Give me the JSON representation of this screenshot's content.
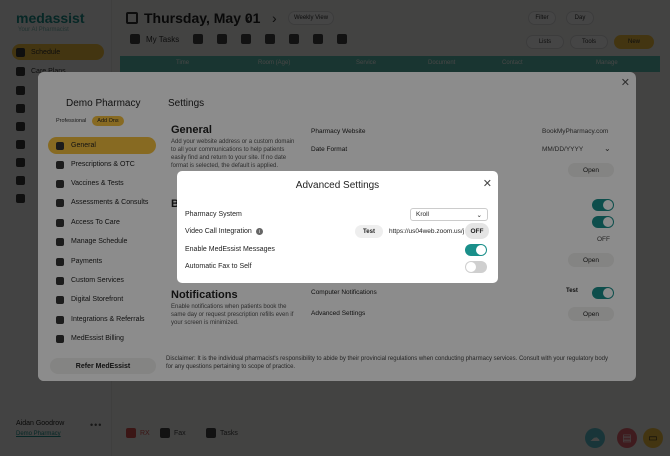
{
  "app": {
    "brand": "medassist",
    "brand_sub": "Your AI Pharmacist",
    "nav": [
      {
        "label": "Schedule",
        "active": true
      },
      {
        "label": "Care Plans",
        "active": false
      },
      {
        "label": "",
        "active": false
      },
      {
        "label": "",
        "active": false
      },
      {
        "label": "",
        "active": false
      },
      {
        "label": "",
        "active": false
      },
      {
        "label": "",
        "active": false
      },
      {
        "label": "",
        "active": false
      },
      {
        "label": "",
        "active": false
      }
    ],
    "user_name": "Aidan Goodrow",
    "user_pharmacy": "Demo Pharmacy",
    "date": "Thursday, May 01",
    "view_toggle": "Weekly View",
    "my_tasks": "My Tasks",
    "filter_labels": [
      "Filter",
      "Day"
    ],
    "toolbar_pills": [
      "Lists",
      "Tools",
      "New"
    ],
    "table_headers": [
      "Time",
      "Room (Age)",
      "Service",
      "Document",
      "Contact",
      "Manage"
    ],
    "bottom_items": [
      "RX",
      "Fax",
      "Tasks"
    ],
    "accent": "#1a8f8a",
    "highlight": "#f6c23e"
  },
  "settings": {
    "pharmacy_name": "Demo Pharmacy",
    "plan": "Professional",
    "add_ons": "Add Ons",
    "title": "Settings",
    "nav": [
      {
        "label": "General",
        "active": true,
        "icon": "gear-icon"
      },
      {
        "label": "Prescriptions & OTC",
        "active": false,
        "icon": "pill-icon"
      },
      {
        "label": "Vaccines & Tests",
        "active": false,
        "icon": "syringe-icon"
      },
      {
        "label": "Assessments & Consults",
        "active": false,
        "icon": "clipboard-icon"
      },
      {
        "label": "Access To Care",
        "active": false,
        "icon": "door-icon"
      },
      {
        "label": "Manage Schedule",
        "active": false,
        "icon": "calendar-icon"
      },
      {
        "label": "Payments",
        "active": false,
        "icon": "card-icon"
      },
      {
        "label": "Custom Services",
        "active": false,
        "icon": "star-icon"
      },
      {
        "label": "Digital Storefront",
        "active": false,
        "icon": "pen-icon"
      },
      {
        "label": "Integrations & Referrals",
        "active": false,
        "icon": "send-icon"
      },
      {
        "label": "MedEssist Billing",
        "active": false,
        "icon": "receipt-icon"
      }
    ],
    "refer": "Refer MedEssist",
    "general": {
      "title": "General",
      "desc": "Add your website address or a custom domain to all your communications to help patients easily find and return to your site. If no date format is selected, the default is applied."
    },
    "b_section_initial": "B",
    "notifications": {
      "title": "Notifications",
      "desc": "Enable notifications when patients book the same day or request prescription refills even if your screen is minimized."
    },
    "rows": {
      "website_label": "Pharmacy Website",
      "website_value": "BookMyPharmacy.com",
      "date_format_label": "Date Format",
      "date_format_value": "MM/DD/YYYY",
      "advanced_label_top": "Advanced Settings",
      "open": "Open",
      "off": "OFF",
      "computer_notifications": "Computer Notifications",
      "test": "Test",
      "advanced_settings": "Advanced Settings"
    },
    "disclaimer": "Disclaimer: It is the individual pharmacist's responsibility to abide by their provincial regulations when conducting pharmacy services. Consult with your regulatory body for any questions pertaining to scope of practice."
  },
  "advanced": {
    "title": "Advanced Settings",
    "pharmacy_system_label": "Pharmacy System",
    "pharmacy_system_value": "Kroll",
    "video_label": "Video Call Integration",
    "test": "Test",
    "video_url": "https://us04web.zoom.us/j/",
    "video_state": "OFF",
    "messages_label": "Enable MedEssist Messages",
    "messages_on": true,
    "fax_label": "Automatic Fax to Self",
    "fax_on": false
  }
}
